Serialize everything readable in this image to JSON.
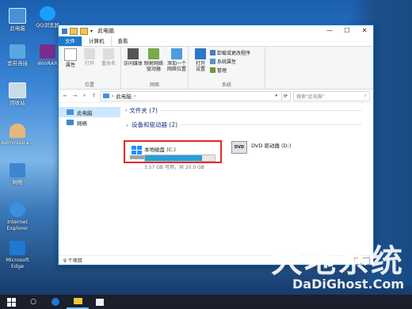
{
  "desktop": {
    "icons": [
      {
        "label": "此电脑"
      },
      {
        "label": "QQ浏览器"
      },
      {
        "label": "宽带连接"
      },
      {
        "label": "WinRAR"
      },
      {
        "label": "回收站"
      },
      {
        "label": "Administra..."
      },
      {
        "label": "网络"
      },
      {
        "label": "Internet Explorer"
      },
      {
        "label": "Microsoft Edge"
      }
    ]
  },
  "window": {
    "title": "此电脑",
    "controls": {
      "minimize": "—",
      "maximize": "☐",
      "close": "✕"
    },
    "tabs": [
      {
        "label": "文件"
      },
      {
        "label": "计算机"
      },
      {
        "label": "查看"
      }
    ],
    "ribbon": {
      "location": {
        "label": "位置",
        "buttons": [
          {
            "label": "属性"
          },
          {
            "label": "打开"
          },
          {
            "label": "重命名"
          }
        ]
      },
      "network": {
        "label": "网络",
        "buttons": [
          {
            "label": "访问媒体"
          },
          {
            "label": "映射网络驱动器"
          },
          {
            "label": "添加一个网络位置"
          }
        ]
      },
      "system": {
        "label": "系统",
        "open_settings": "打开设置",
        "items": [
          {
            "label": "卸载或更改程序"
          },
          {
            "label": "系统属性"
          },
          {
            "label": "管理"
          }
        ]
      }
    },
    "address": {
      "path": "此电脑",
      "search_placeholder": "搜索\"此电脑\""
    },
    "nav_pane": [
      {
        "label": "此电脑"
      },
      {
        "label": "网络"
      }
    ],
    "content": {
      "folders_header": "文件夹 (7)",
      "devices_header": "设备和驱动器 (2)",
      "drives": [
        {
          "name": "本地磁盘 (C:)",
          "free_text": "3.57 GB 可用，共 20.0 GB",
          "used_fraction": 0.82
        },
        {
          "name": "DVD 驱动器 (D:)"
        }
      ]
    },
    "status": "9 个项目"
  },
  "watermark": {
    "cn": "大地系统",
    "en": "DaDiGhost.Com"
  },
  "colors": {
    "accent": "#1979ca",
    "highlight": "#e8262b",
    "bar": "#26a0da"
  }
}
